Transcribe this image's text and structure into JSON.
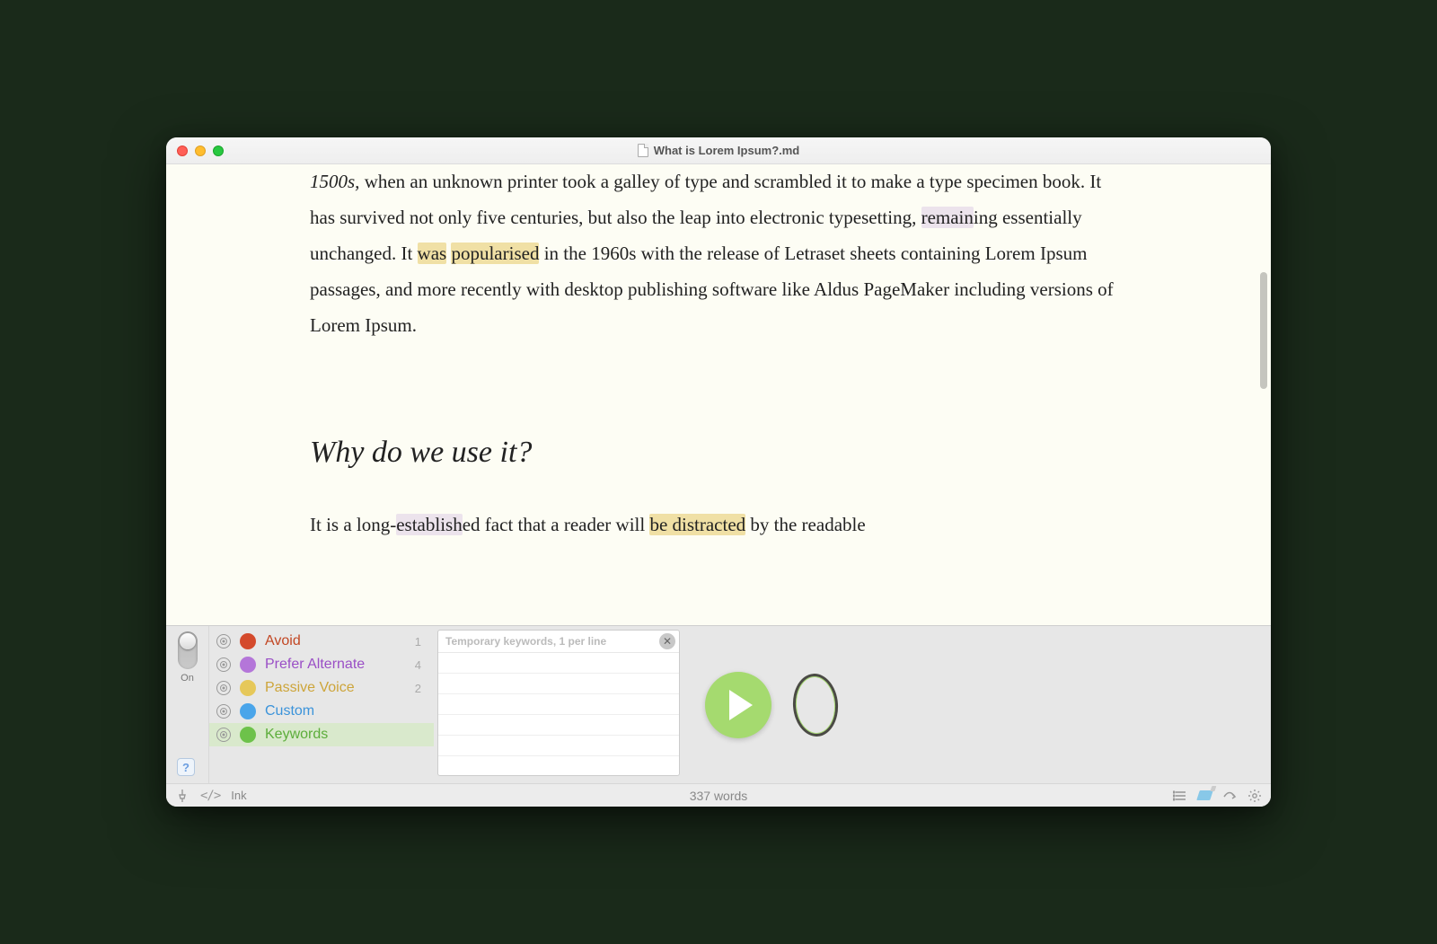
{
  "window": {
    "title": "What is Lorem Ipsum?.md"
  },
  "document": {
    "para1_a_italic": "1500s,",
    "para1_b": " when an unknown printer took a galley of type and scrambled it to make a type specimen book. It has survived not only five centuries, but also the leap into electronic typesetting, ",
    "para1_remain": "remain",
    "para1_c": "ing essentially unchanged. It ",
    "para1_was": "was",
    "para1_d": " ",
    "para1_pop": "popularised",
    "para1_e": " in the 1960s with the release of Letraset sheets containing Lorem Ipsum passages, and more recently with desktop publishing software like Aldus PageMaker including versions of Lorem Ipsum.",
    "heading2": "Why do we use it?",
    "para2_a": "It is a long-",
    "para2_estab": "establish",
    "para2_b": "ed fact that a reader will ",
    "para2_bedist": "be distracted",
    "para2_c": " by the readable"
  },
  "panel": {
    "switch_label": "On",
    "help": "?",
    "categories": [
      {
        "label": "Avoid",
        "count": "1",
        "color": "#d44a2c",
        "textcolor": "#c24723"
      },
      {
        "label": "Prefer Alternate",
        "count": "4",
        "color": "#b476d9",
        "textcolor": "#9a4fc6"
      },
      {
        "label": "Passive Voice",
        "count": "2",
        "color": "#e6c85a",
        "textcolor": "#cda53a"
      },
      {
        "label": "Custom",
        "count": "",
        "color": "#4aa5ea",
        "textcolor": "#3b93da"
      },
      {
        "label": "Keywords",
        "count": "",
        "color": "#6dc24a",
        "textcolor": "#5cad3b",
        "selected": true
      }
    ],
    "keywords_placeholder": "Temporary keywords, 1 per line"
  },
  "statusbar": {
    "mode": "Ink",
    "word_count": "337 words"
  }
}
